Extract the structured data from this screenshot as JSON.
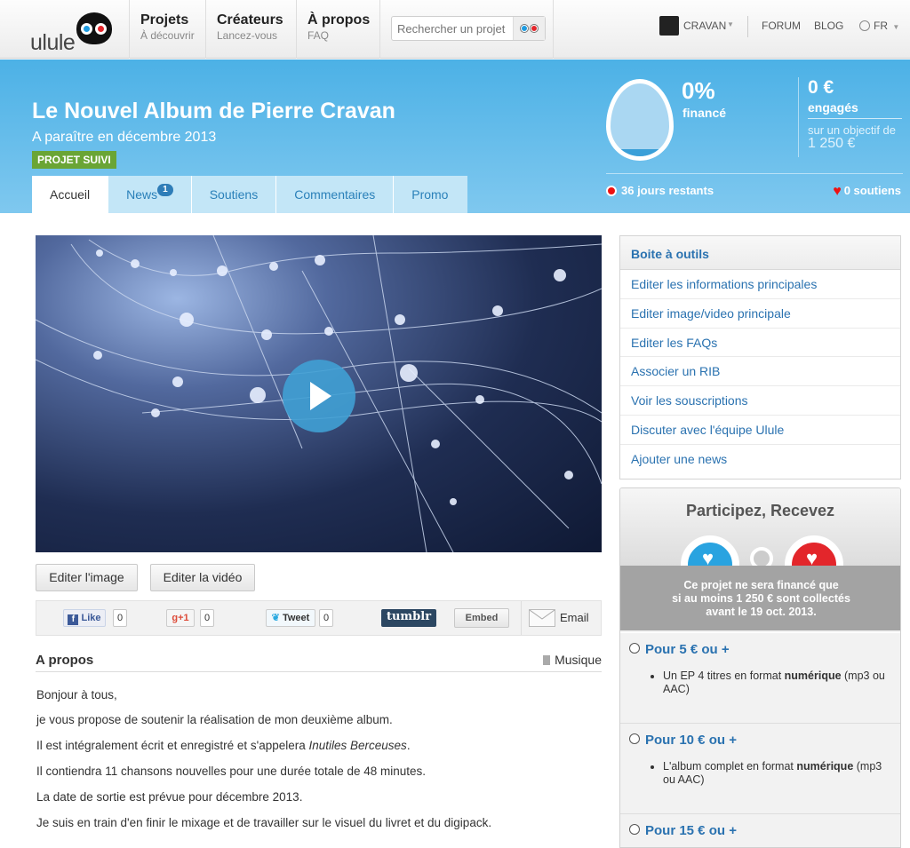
{
  "header": {
    "logo_text": "ulule",
    "nav": [
      {
        "title": "Projets",
        "subtitle": "À découvrir"
      },
      {
        "title": "Créateurs",
        "subtitle": "Lancez-vous"
      },
      {
        "title": "À propos",
        "subtitle": "FAQ"
      }
    ],
    "search_placeholder": "Rechercher un projet",
    "user_name": "CRAVAN",
    "links": [
      "FORUM",
      "BLOG",
      "FR"
    ]
  },
  "project": {
    "title": "Le Nouvel Album de Pierre Cravan",
    "subtitle": "A paraître en décembre 2013",
    "badge": "PROJET SUIVI",
    "tabs": [
      {
        "label": "Accueil",
        "badge": ""
      },
      {
        "label": "News",
        "badge": "1"
      },
      {
        "label": "Soutiens",
        "badge": ""
      },
      {
        "label": "Commentaires",
        "badge": ""
      },
      {
        "label": "Promo",
        "badge": ""
      }
    ]
  },
  "stats": {
    "percent": "0%",
    "percent_label": "financé",
    "amount": "0 €",
    "amount_label": "engagés",
    "goal_label": "sur un objectif de",
    "goal_value": "1 250 €",
    "days": "36 jours restants",
    "supporters": "0 soutiens",
    "funded_fraction": 0
  },
  "media": {
    "edit_image": "Editer l'image",
    "edit_video": "Editer la vidéo"
  },
  "share": {
    "like": "Like",
    "like_count": "0",
    "gplus": "+1",
    "gplus_count": "0",
    "tweet": "Tweet",
    "tweet_count": "0",
    "tumblr": "tumblr",
    "embed": "Embed",
    "email": "Email"
  },
  "about": {
    "heading": "A propos",
    "category": "Musique",
    "p1": "Bonjour à tous,",
    "p2": "je vous propose de soutenir la réalisation de mon deuxième album.",
    "p3_a": "Il est intégralement écrit et enregistré et s'appelera ",
    "p3_em": "Inutiles Berceuses",
    "p3_b": ".",
    "p4": "Il contiendra 11 chansons nouvelles pour une durée totale de 48 minutes.",
    "p5": "La date de sortie est prévue pour décembre 2013.",
    "p6": "Je suis en train d'en finir le mixage et de travailler sur le visuel du livret et du digipack."
  },
  "toolbox": {
    "title": "Boite à outils",
    "items": [
      "Editer les informations principales",
      "Editer image/video principale",
      "Editer les FAQs",
      "Associer un RIB",
      "Voir les souscriptions",
      "Discuter avec l'équipe Ulule",
      "Ajouter une news"
    ]
  },
  "rewards": {
    "title": "Participez, Recevez",
    "notice_1": "Ce projet ne sera financé que",
    "notice_2": "si au moins 1 250 € sont collectés",
    "notice_3": "avant le 19 oct. 2013.",
    "items": [
      {
        "title": "Pour 5 € ou +",
        "desc_a": "Un EP  4 titres en format ",
        "desc_b": "numérique",
        "desc_c": " (mp3 ou AAC)"
      },
      {
        "title": "Pour 10 € ou +",
        "desc_a": "L'album complet en format ",
        "desc_b": "numérique",
        "desc_c": " (mp3 ou AAC)"
      },
      {
        "title": "Pour 15 € ou +",
        "desc_a": "",
        "desc_b": "",
        "desc_c": ""
      }
    ]
  },
  "colors": {
    "brand_blue": "#4cb1e6",
    "link_blue": "#2a72b0",
    "badge_green": "#6aa535",
    "heart_red": "#e11111"
  }
}
